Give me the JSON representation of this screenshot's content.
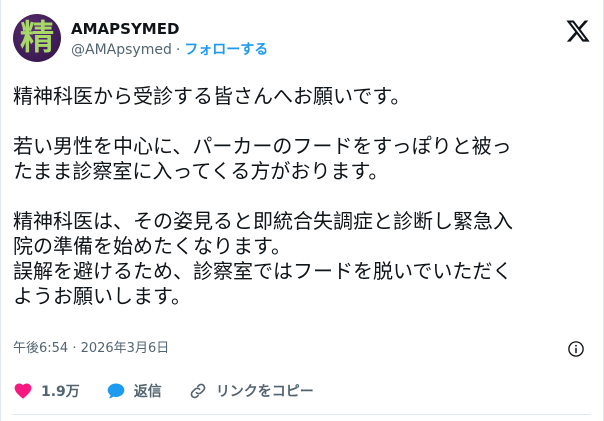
{
  "author": {
    "avatar_glyph": "精",
    "display_name": "AMAPSYMED",
    "handle": "@AMApsymed",
    "separator": "·",
    "follow_label": "フォローする"
  },
  "tweet": {
    "paragraph_1": "精神科医から受診する皆さんへお願いです。",
    "paragraph_2_line_1": "若い男性を中心に、パーカーのフードをすっぽりと被っ",
    "paragraph_2_line_2": "たまま診察室に入ってくる方がおります。",
    "paragraph_3_line_1": "精神科医は、その姿見ると即統合失調症と診断し緊急入",
    "paragraph_3_line_2": "院の準備を始めたくなります。",
    "paragraph_4_line_1": "誤解を避けるため、診察室ではフードを脱いでいただく",
    "paragraph_4_line_2": "ようお願いします。"
  },
  "meta": {
    "timestamp": "午後6:54 · 2026年3月6日"
  },
  "actions": {
    "like_count": "1.9万",
    "reply_label": "返信",
    "copy_link_label": "リンクをコピー"
  },
  "colors": {
    "accent": "#1d9bf0",
    "like": "#f91880",
    "reply": "#1d9bf0",
    "muted": "#536471",
    "text": "#0f1419"
  },
  "icons": {
    "logo": "x-logo-icon",
    "info": "info-icon",
    "like": "heart-icon",
    "reply": "speech-bubble-icon",
    "copy_link": "link-icon"
  }
}
